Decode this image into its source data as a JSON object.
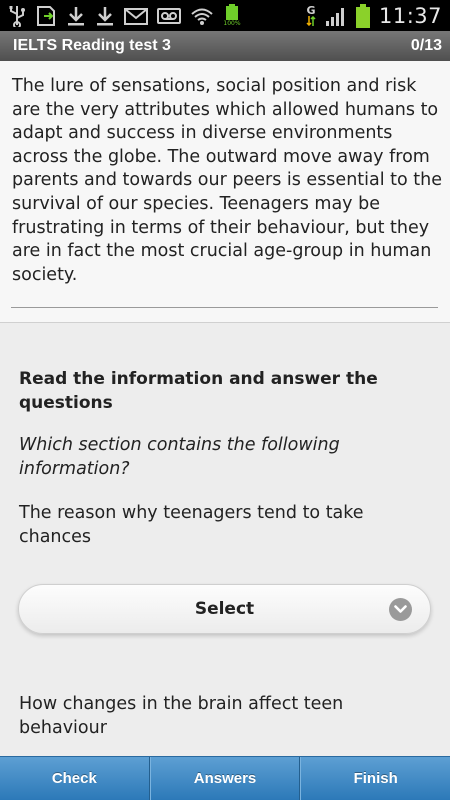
{
  "status_bar": {
    "time": "11:37",
    "battery_small_label": "100%",
    "network_label": "G",
    "icons": [
      "usb-icon",
      "sd-card-icon",
      "download-icon",
      "download-icon",
      "gmail-icon",
      "voicemail-icon",
      "wifi-icon",
      "battery-small-icon",
      "network-g-icon",
      "signal-icon",
      "battery-icon"
    ]
  },
  "title_bar": {
    "title": "IELTS Reading test 3",
    "progress": "0/13"
  },
  "passage": {
    "text": "The lure of sensations, social position and risk are the very attributes which allowed humans to adapt and success in diverse environments across the globe. The outward move away from parents and towards our peers is essential to the survival of our species. Teenagers may be frustrating in terms of their behaviour, but they are in fact the most crucial age-group in human society."
  },
  "question": {
    "heading": "Read the information and answer the questions",
    "instruction": "Which section contains the following information?",
    "item_1": "The reason why teenagers tend to take chances",
    "select_label": "Select",
    "item_2": "How changes in the brain affect teen behaviour"
  },
  "toolbar": {
    "check_label": "Check",
    "answers_label": "Answers",
    "finish_label": "Finish"
  },
  "colors": {
    "toolbar": "#3d89c6",
    "battery": "#8bd12a",
    "title_bar": "#5e5e5e"
  }
}
